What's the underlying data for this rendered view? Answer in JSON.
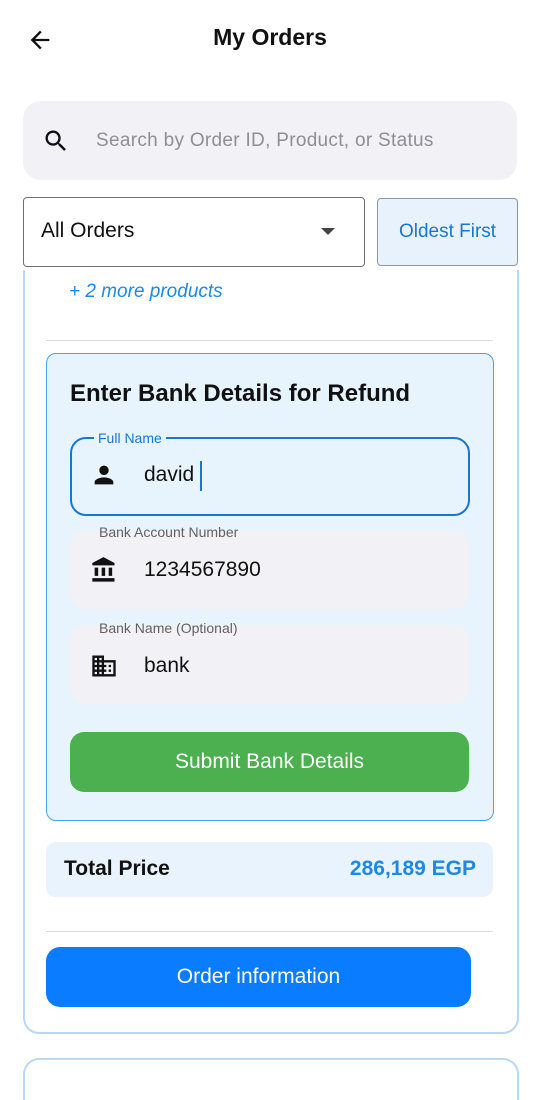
{
  "header": {
    "title": "My Orders"
  },
  "search": {
    "placeholder": "Search by Order ID, Product, or Status",
    "value": ""
  },
  "filters": {
    "status_selected": "All Orders",
    "sort_label": "Oldest First"
  },
  "order": {
    "more_products": "+ 2 more products",
    "refund": {
      "title": "Enter Bank Details for Refund",
      "full_name": {
        "label": "Full Name",
        "value": "david",
        "icon": "person-icon"
      },
      "account_number": {
        "label": "Bank Account Number",
        "value": "1234567890",
        "icon": "bank-icon"
      },
      "bank_name": {
        "label": "Bank Name (Optional)",
        "value": "bank",
        "icon": "building-icon"
      },
      "submit_label": "Submit Bank Details"
    },
    "total": {
      "label": "Total Price",
      "value": "286,189 EGP"
    },
    "order_info_label": "Order information"
  },
  "colors": {
    "accent_blue": "#1976d2",
    "price_blue": "#1e88e5",
    "submit_green": "#4caf50",
    "order_button_blue": "#0a7cff"
  }
}
